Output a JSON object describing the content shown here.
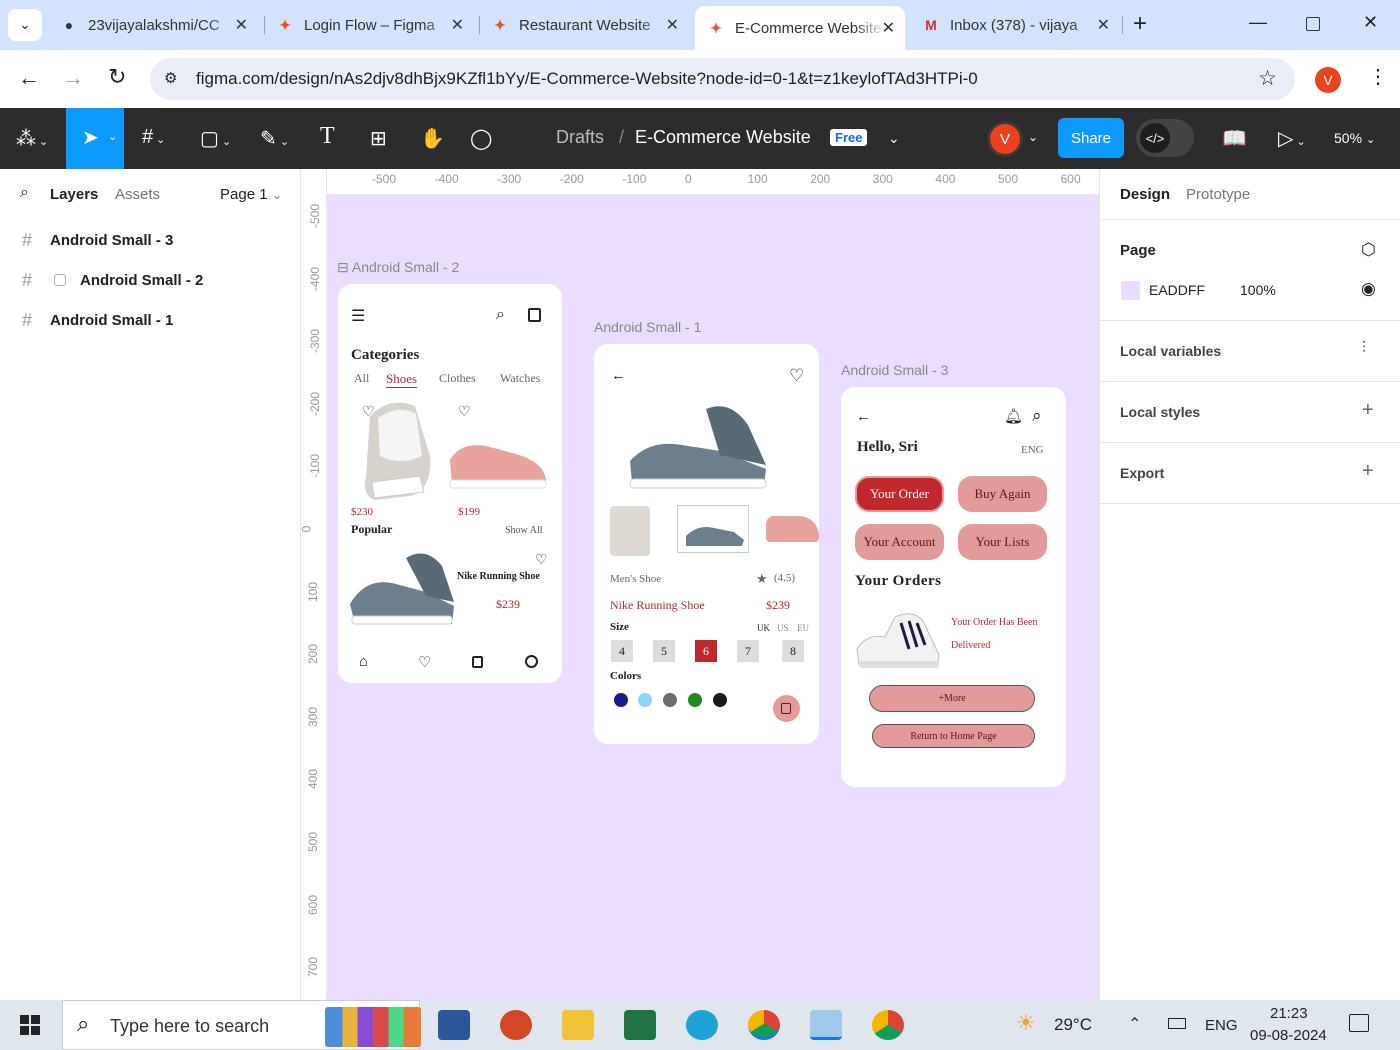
{
  "browser": {
    "tabs": [
      {
        "title": "23vijayalakshmi/CC",
        "icon": "github-icon"
      },
      {
        "title": "Login Flow – Figma",
        "icon": "figma-icon"
      },
      {
        "title": "Restaurant Website",
        "icon": "figma-icon"
      },
      {
        "title": "E-Commerce Website",
        "icon": "figma-icon",
        "active": true
      },
      {
        "title": "Inbox (378) - vijaya",
        "icon": "gmail-icon"
      }
    ],
    "url": "figma.com/design/nAs2djv8dhBjx9KZfl1bYy/E-Commerce-Website?node-id=0-1&t=z1keylofTAd3HTPi-0",
    "profile_initial": "V"
  },
  "figma": {
    "breadcrumb_root": "Drafts",
    "breadcrumb_sep": "/",
    "file_name": "E-Commerce Website",
    "plan_badge": "Free",
    "user_initial": "V",
    "share_label": "Share",
    "zoom": "50%",
    "left_tabs": {
      "layers": "Layers",
      "assets": "Assets",
      "page": "Page 1"
    },
    "layers": [
      "Android Small - 3",
      "Android Small - 2",
      "Android Small - 1"
    ],
    "right_tabs": {
      "design": "Design",
      "prototype": "Prototype"
    },
    "page_section": {
      "title": "Page",
      "color_hex": "EADDFF",
      "opacity": "100%",
      "color": "#eaddff"
    },
    "sections": [
      "Local variables",
      "Local styles",
      "Export"
    ],
    "ruler_h": [
      "-500",
      "-400",
      "-300",
      "-200",
      "-100",
      "0",
      "100",
      "200",
      "300",
      "400",
      "500",
      "600"
    ],
    "ruler_v": [
      "-500",
      "-400",
      "-300",
      "-200",
      "-100",
      "0",
      "100",
      "200",
      "300",
      "400",
      "500",
      "600",
      "700"
    ]
  },
  "frames": {
    "f2": {
      "label": "Android Small - 2",
      "categories_title": "Categories",
      "tabs": [
        "All",
        "Shoes",
        "Clothes",
        "Watches"
      ],
      "price1": "$230",
      "price2": "$199",
      "popular": "Popular",
      "show_all": "Show All",
      "product_name": "Nike Running Shoe",
      "product_price": "$239"
    },
    "f1": {
      "label": "Android Small - 1",
      "category": "Men's Shoe",
      "rating": "(4.5)",
      "name": "Nike Running Shoe",
      "price": "$239",
      "size_label": "Size",
      "size_units": [
        "UK",
        "US",
        "EU"
      ],
      "sizes": [
        "4",
        "5",
        "6",
        "7",
        "8"
      ],
      "selected_size": "6",
      "colors_label": "Colors",
      "colors": [
        "#1a1a8c",
        "#8fd3f5",
        "#6b6b6b",
        "#1f8c1f",
        "#1a1a1a"
      ]
    },
    "f3": {
      "label": "Android Small - 3",
      "greeting": "Hello, Sri",
      "lang": "ENG",
      "buttons": [
        "Your Order",
        "Buy Again",
        "Your Account",
        "Your Lists"
      ],
      "orders_title": "Your Orders",
      "order_status_1": "Your Order Has Been",
      "order_status_2": "Delivered",
      "more": "+More",
      "return": "Return to Home Page"
    }
  },
  "taskbar": {
    "search_placeholder": "Type here to search",
    "weather": "29°C",
    "lang": "ENG",
    "time": "21:23",
    "date": "09-08-2024"
  }
}
